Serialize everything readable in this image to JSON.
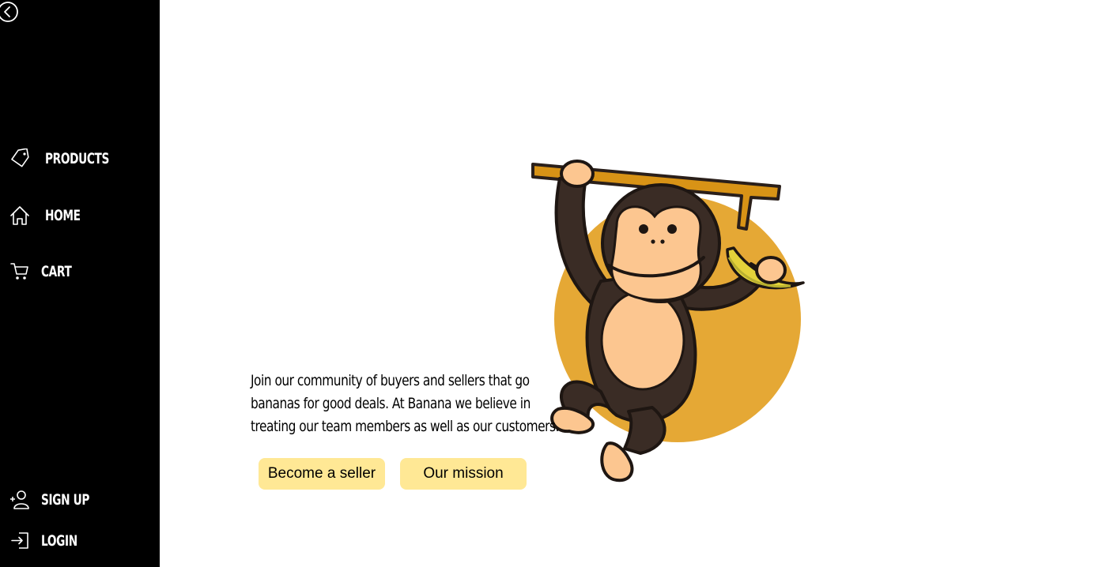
{
  "sidebar": {
    "collapse_icon": "chevron-left-circle-icon",
    "top_items": [
      {
        "label": "PRODUCTS",
        "icon": "tag-icon"
      },
      {
        "label": "HOME",
        "icon": "home-icon"
      },
      {
        "label": "CART",
        "icon": "cart-icon"
      }
    ],
    "bottom_items": [
      {
        "label": "SIGN UP",
        "icon": "add-user-icon"
      },
      {
        "label": "LOGIN",
        "icon": "login-icon"
      }
    ]
  },
  "hero": {
    "tagline": "Join our community of buyers and sellers that go bananas for good deals. At Banana we believe in treating our team members as well as our customers.",
    "primary_button": "Become a seller",
    "secondary_button": "Our mission",
    "mascot": "monkey-hanging-from-branch-holding-banana"
  },
  "colors": {
    "sidebar_bg": "#000000",
    "sidebar_text": "#ffffff",
    "button_bg": "#ffe895",
    "mascot_circle": "#e5a835",
    "mascot_fur": "#3a2c25",
    "mascot_skin": "#fcc690",
    "branch": "#d89316"
  }
}
